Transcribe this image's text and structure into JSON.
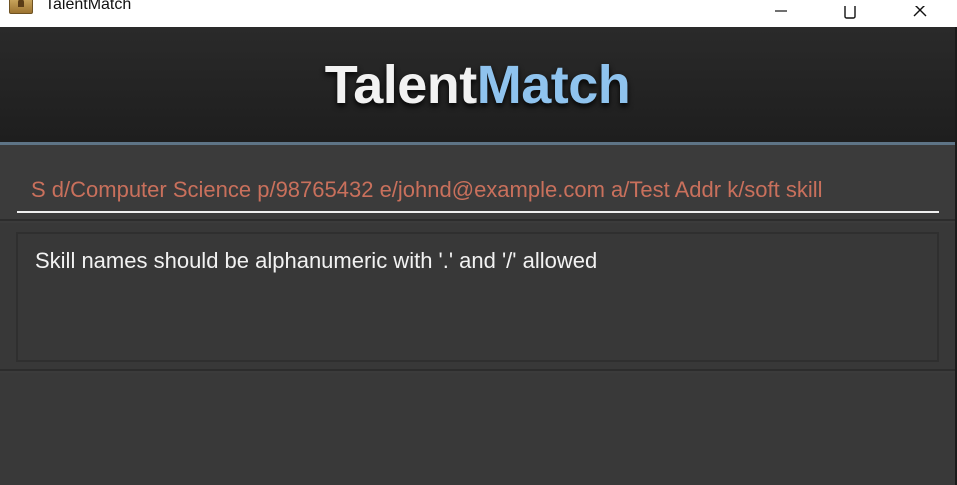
{
  "window": {
    "title": "TalentMatch",
    "icon": "app-icon",
    "controls": [
      "minimize-icon",
      "maximize-icon",
      "close-icon"
    ]
  },
  "header": {
    "brand_part_a": "Talent",
    "brand_part_b": "Match",
    "colors": {
      "part_a": "#f2f2f2",
      "part_b": "#8fc3ee",
      "accent_border": "#5e7486"
    }
  },
  "command": {
    "value": "S d/Computer Science p/98765432 e/johnd@example.com a/Test Addr k/soft skill",
    "text_color": "#c9705c"
  },
  "result": {
    "message": "Skill names should be alphanumeric with '.' and '/' allowed"
  }
}
